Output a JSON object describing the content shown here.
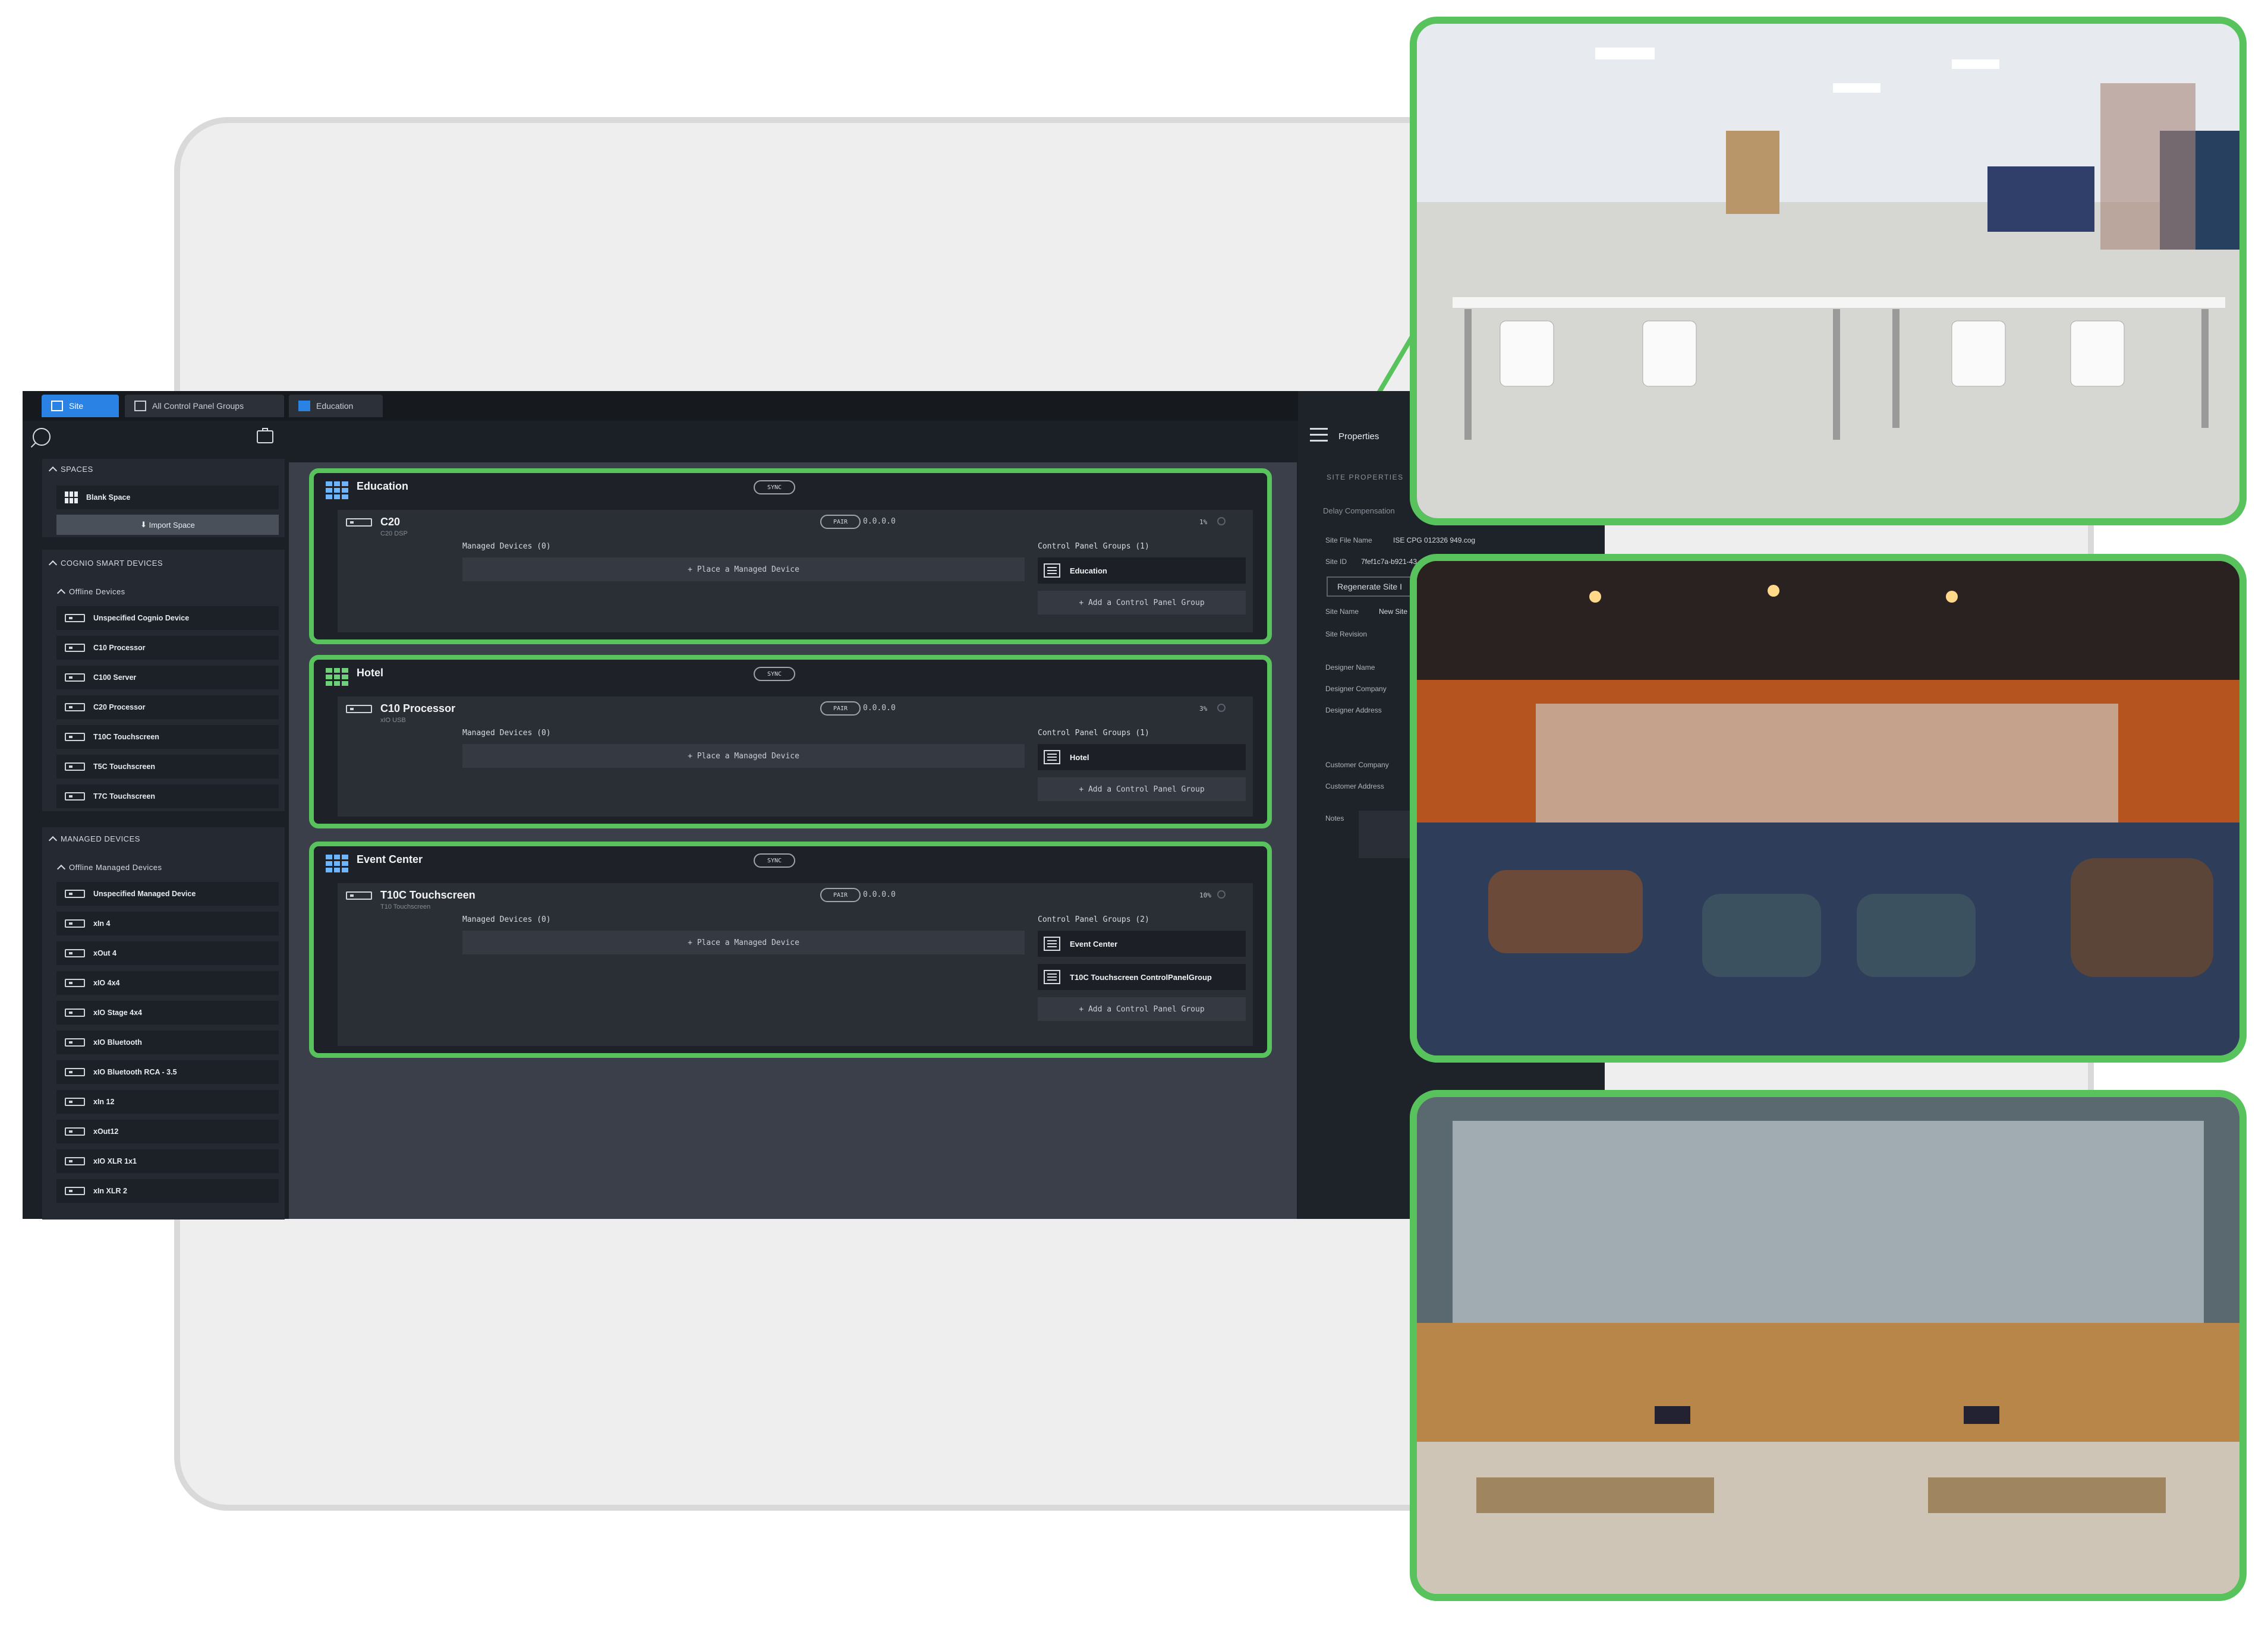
{
  "tabs": [
    {
      "label": "Site"
    },
    {
      "label": "All Control Panel Groups"
    },
    {
      "label": "Education"
    }
  ],
  "sidebar": {
    "spaces_header": "SPACES",
    "blank_space": "Blank Space",
    "import_space": "Import Space",
    "cognio_header": "COGNIO SMART DEVICES",
    "offline_devices": "Offline Devices",
    "cognio_items": [
      "Unspecified Cognio Device",
      "C10 Processor",
      "C100 Server",
      "C20 Processor",
      "T10C Touchscreen",
      "T5C Touchscreen",
      "T7C Touchscreen"
    ],
    "managed_header": "MANAGED DEVICES",
    "offline_managed": "Offline Managed Devices",
    "managed_items": [
      "Unspecified Managed Device",
      "xIn 4",
      "xOut 4",
      "xIO 4x4",
      "xIO Stage 4x4",
      "xIO Bluetooth",
      "xIO Bluetooth RCA - 3.5",
      "xIn 12",
      "xOut12",
      "xIO XLR 1x1",
      "xIn XLR 2"
    ]
  },
  "labels": {
    "sync": "SYNC",
    "pair": "PAIR",
    "managed_devices": "Managed Devices (0)",
    "place_device": "+ Place a Managed Device",
    "add_group": "+ Add a Control Panel Group"
  },
  "spaces": [
    {
      "title": "Education",
      "device": "C20",
      "device_sub": "C20 DSP",
      "ip": "0.0.0.0",
      "pct": "1%",
      "cpg_header": "Control Panel Groups (1)",
      "groups": [
        "Education"
      ]
    },
    {
      "title": "Hotel",
      "device": "C10 Processor",
      "device_sub": "xIO USB",
      "ip": "0.0.0.0",
      "pct": "3%",
      "cpg_header": "Control Panel Groups (1)",
      "groups": [
        "Hotel"
      ]
    },
    {
      "title": "Event Center",
      "device": "T10C Touchscreen",
      "device_sub": "T10 Touchscreen",
      "ip": "0.0.0.0",
      "pct": "10%",
      "cpg_header": "Control Panel Groups (2)",
      "groups": [
        "Event Center",
        "T10C Touchscreen ControlPanelGroup"
      ]
    }
  ],
  "properties": {
    "tab": "Properties",
    "site_properties": "SITE PROPERTIES",
    "delay_compensation": "Delay Compensation",
    "site_file_name_label": "Site File Name",
    "site_file_name_value": "ISE CPG 012326 949.cog",
    "site_id_label": "Site ID",
    "site_id_value": "7fef1c7a-b921-43",
    "regenerate": "Regenerate Site I",
    "site_name_label": "Site Name",
    "site_name_value": "New Site",
    "site_revision": "Site Revision",
    "designer_name": "Designer Name",
    "designer_company": "Designer Company",
    "designer_address": "Designer Address",
    "customer_company": "Customer Company",
    "customer_address": "Customer Address",
    "notes": "Notes"
  },
  "colors": {
    "accent_green": "#58c35d",
    "accent_blue": "#2a82e4",
    "app_bg": "#1b2027"
  }
}
